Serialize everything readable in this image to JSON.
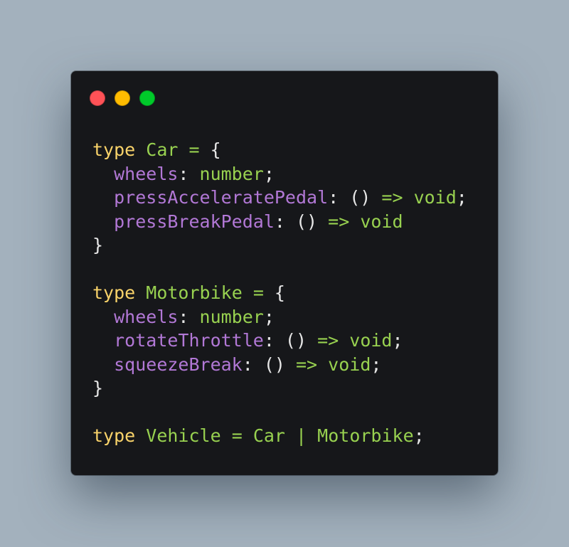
{
  "colors": {
    "background": "#a3b1bd",
    "window": "#16171a",
    "dot_close": "#ff5257",
    "dot_minimize": "#ffbb00",
    "dot_maximize": "#00c92a",
    "keyword": "#f9d36a",
    "type_name": "#98d150",
    "property": "#b278d6",
    "punctuation": "#e6e6e6"
  },
  "window_controls": [
    {
      "name": "close",
      "color": "#ff5257"
    },
    {
      "name": "minimize",
      "color": "#ffbb00"
    },
    {
      "name": "maximize",
      "color": "#00c92a"
    }
  ],
  "code_lines": [
    [
      {
        "t": "type",
        "c": "keyword"
      },
      {
        "t": " ",
        "c": "punctuation"
      },
      {
        "t": "Car",
        "c": "type_name"
      },
      {
        "t": " ",
        "c": "punctuation"
      },
      {
        "t": "=",
        "c": "type_name"
      },
      {
        "t": " {",
        "c": "punctuation"
      }
    ],
    [
      {
        "t": "  ",
        "c": "punctuation"
      },
      {
        "t": "wheels",
        "c": "property"
      },
      {
        "t": ": ",
        "c": "punctuation"
      },
      {
        "t": "number",
        "c": "type_name"
      },
      {
        "t": ";",
        "c": "punctuation"
      }
    ],
    [
      {
        "t": "  ",
        "c": "punctuation"
      },
      {
        "t": "pressAcceleratePedal",
        "c": "property"
      },
      {
        "t": ": () ",
        "c": "punctuation"
      },
      {
        "t": "=>",
        "c": "type_name"
      },
      {
        "t": " ",
        "c": "punctuation"
      },
      {
        "t": "void",
        "c": "type_name"
      },
      {
        "t": ";",
        "c": "punctuation"
      }
    ],
    [
      {
        "t": "  ",
        "c": "punctuation"
      },
      {
        "t": "pressBreakPedal",
        "c": "property"
      },
      {
        "t": ": () ",
        "c": "punctuation"
      },
      {
        "t": "=>",
        "c": "type_name"
      },
      {
        "t": " ",
        "c": "punctuation"
      },
      {
        "t": "void",
        "c": "type_name"
      }
    ],
    [
      {
        "t": "}",
        "c": "punctuation"
      }
    ],
    [],
    [
      {
        "t": "type",
        "c": "keyword"
      },
      {
        "t": " ",
        "c": "punctuation"
      },
      {
        "t": "Motorbike",
        "c": "type_name"
      },
      {
        "t": " ",
        "c": "punctuation"
      },
      {
        "t": "=",
        "c": "type_name"
      },
      {
        "t": " {",
        "c": "punctuation"
      }
    ],
    [
      {
        "t": "  ",
        "c": "punctuation"
      },
      {
        "t": "wheels",
        "c": "property"
      },
      {
        "t": ": ",
        "c": "punctuation"
      },
      {
        "t": "number",
        "c": "type_name"
      },
      {
        "t": ";",
        "c": "punctuation"
      }
    ],
    [
      {
        "t": "  ",
        "c": "punctuation"
      },
      {
        "t": "rotateThrottle",
        "c": "property"
      },
      {
        "t": ": () ",
        "c": "punctuation"
      },
      {
        "t": "=>",
        "c": "type_name"
      },
      {
        "t": " ",
        "c": "punctuation"
      },
      {
        "t": "void",
        "c": "type_name"
      },
      {
        "t": ";",
        "c": "punctuation"
      }
    ],
    [
      {
        "t": "  ",
        "c": "punctuation"
      },
      {
        "t": "squeezeBreak",
        "c": "property"
      },
      {
        "t": ": () ",
        "c": "punctuation"
      },
      {
        "t": "=>",
        "c": "type_name"
      },
      {
        "t": " ",
        "c": "punctuation"
      },
      {
        "t": "void",
        "c": "type_name"
      },
      {
        "t": ";",
        "c": "punctuation"
      }
    ],
    [
      {
        "t": "}",
        "c": "punctuation"
      }
    ],
    [],
    [
      {
        "t": "type",
        "c": "keyword"
      },
      {
        "t": " ",
        "c": "punctuation"
      },
      {
        "t": "Vehicle",
        "c": "type_name"
      },
      {
        "t": " ",
        "c": "punctuation"
      },
      {
        "t": "=",
        "c": "type_name"
      },
      {
        "t": " ",
        "c": "punctuation"
      },
      {
        "t": "Car",
        "c": "type_name"
      },
      {
        "t": " ",
        "c": "punctuation"
      },
      {
        "t": "|",
        "c": "type_name"
      },
      {
        "t": " ",
        "c": "punctuation"
      },
      {
        "t": "Motorbike",
        "c": "type_name"
      },
      {
        "t": ";",
        "c": "punctuation"
      }
    ]
  ]
}
